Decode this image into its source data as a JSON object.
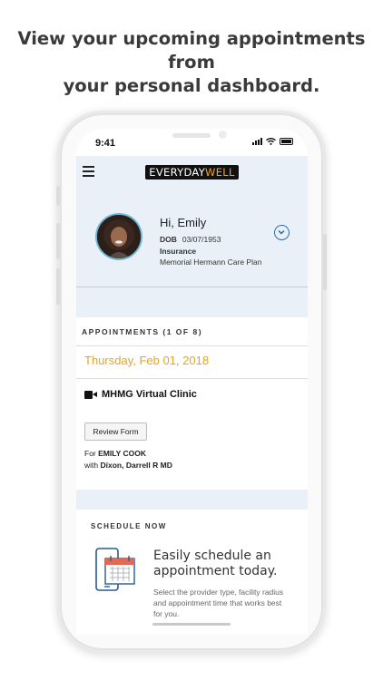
{
  "promo": {
    "line1": "View your upcoming appointments from",
    "line2": "your personal dashboard."
  },
  "status_bar": {
    "time": "9:41",
    "icons": [
      "signal-icon",
      "wifi-icon",
      "battery-icon"
    ]
  },
  "header": {
    "menu_icon": "hamburger-menu-icon",
    "logo_part1": "EVERYDAY",
    "logo_part2": "WELL"
  },
  "profile": {
    "greeting": "Hi, Emily",
    "dob_label": "DOB",
    "dob_value": "03/07/1953",
    "insurance_label": "Insurance",
    "insurance_plan": "Memorial Hermann Care Plan",
    "expand_icon": "chevron-down-circle-icon"
  },
  "appointments": {
    "heading": "APPOINTMENTS (1 OF 8)",
    "date": "Thursday, Feb 01, 2018",
    "clinic_icon": "video-camera-icon",
    "clinic": "MHMG Virtual Clinic",
    "review_button": "Review Form",
    "for_prefix": "For",
    "patient": "EMILY COOK",
    "with_prefix": "with",
    "provider": "Dixon, Darrell R MD"
  },
  "schedule": {
    "heading": "SCHEDULE NOW",
    "icon": "phone-calendar-icon",
    "title": "Easily schedule an appointment today.",
    "description": "Select the provider type, facility radius and appointment time that works best for you."
  },
  "colors": {
    "accent_orange": "#e8a320",
    "header_band": "#eaf0f7",
    "link_blue": "#2a6ca6"
  }
}
